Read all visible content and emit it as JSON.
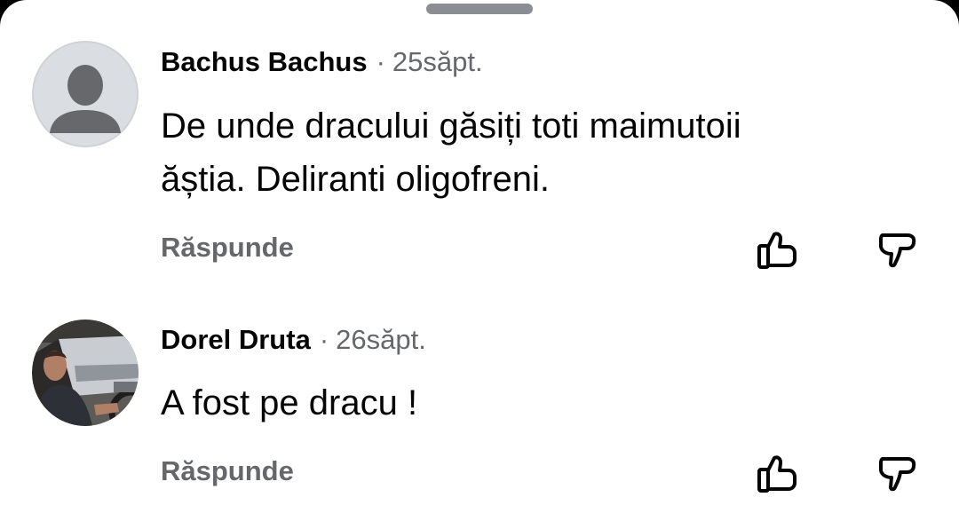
{
  "comments": [
    {
      "author": "Bachus Bachus",
      "separator": "·",
      "time": "25săpt.",
      "text_lines": [
        "De unde dracului găsiți toti maimutoii",
        "ăștia. Deliranti oligofreni."
      ],
      "reply_label": "Răspunde",
      "avatar": "default-profile-silhouette"
    },
    {
      "author": "Dorel Druta",
      "separator": "·",
      "time": "26săpt.",
      "text_lines": [
        "A fost pe dracu !"
      ],
      "reply_label": "Răspunde",
      "avatar": "profile-photo-man-driving-car"
    }
  ],
  "icons": {
    "upvote": "thumbs-up-outline-icon",
    "downvote": "thumbs-down-outline-icon"
  },
  "colors": {
    "text_primary": "#050505",
    "text_secondary": "#65676b",
    "icon": "#050505",
    "handle": "#8a8d91",
    "default_avatar_bg": "#dadde1",
    "default_avatar_fg": "#67686b"
  }
}
